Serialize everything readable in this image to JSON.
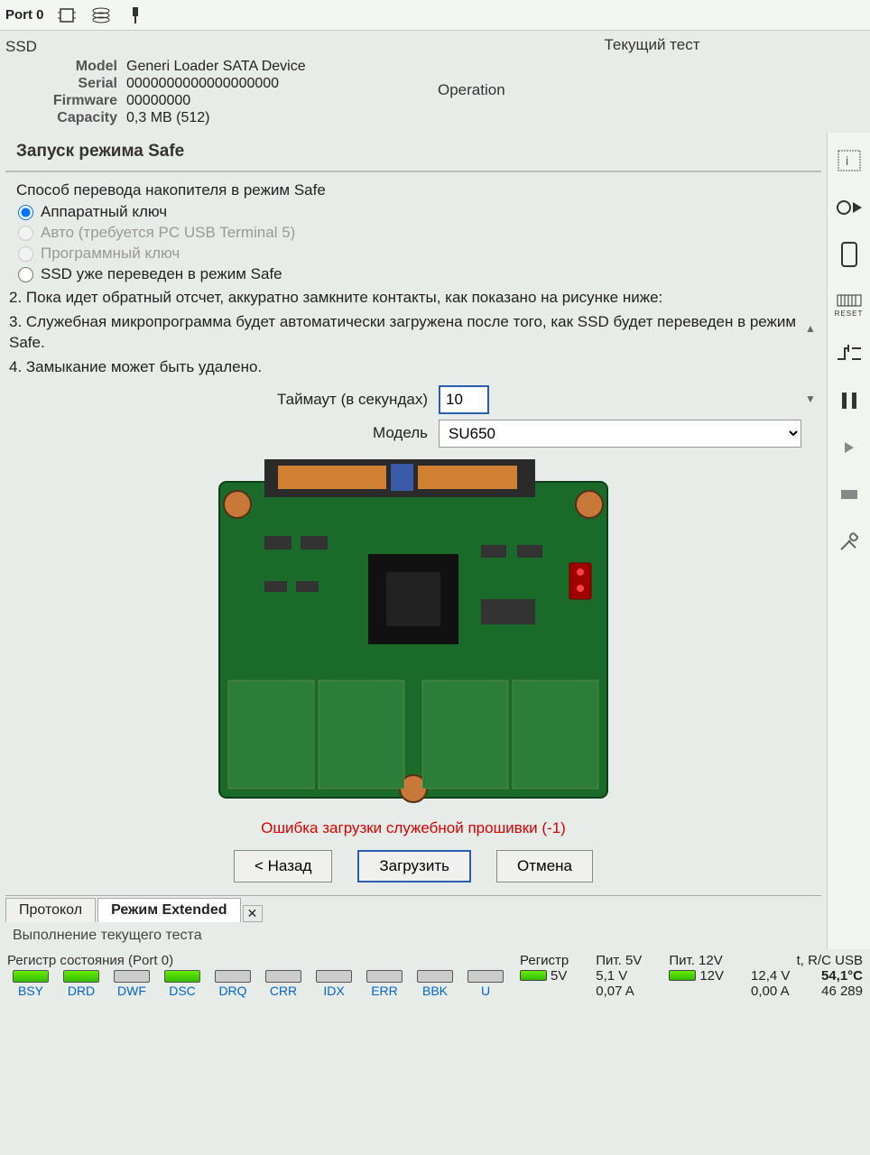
{
  "toolbar": {
    "port_label": "Port 0"
  },
  "info": {
    "ssd_tab": "SSD",
    "model_label": "Model",
    "model_value": "Generi Loader SATA Device",
    "serial_label": "Serial",
    "serial_value": "0000000000000000000",
    "firmware_label": "Firmware",
    "firmware_value": "00000000",
    "capacity_label": "Capacity",
    "capacity_value": "0,3 MB (512)"
  },
  "test": {
    "current_test_label": "Текущий тест",
    "operation_label": "Operation"
  },
  "panel": {
    "title": "Запуск режима Safe",
    "method_label": "Способ перевода накопителя в режим Safe",
    "radio": {
      "hw_key": "Аппаратный ключ",
      "auto": "Авто (требуется PC USB Terminal 5)",
      "sw_key": "Программный ключ",
      "already_safe": "SSD уже переведен в режим Safe"
    },
    "instructions": {
      "step2": "2. Пока идет обратный отсчет, аккуратно замкните контакты, как показано на рисунке ниже:",
      "step3": "3. Служебная микропрограмма будет автоматически загружена после того, как SSD будет переведен в режим Safe.",
      "step4": "4. Замыкание может быть удалено."
    },
    "timeout_label": "Таймаут (в секундах)",
    "timeout_value": "10",
    "model_label": "Модель",
    "model_selected": "SU650",
    "error_message": "Ошибка загрузки служебной прошивки (-1)",
    "buttons": {
      "back": "< Назад",
      "load": "Загрузить",
      "cancel": "Отмена"
    }
  },
  "tabs": {
    "protocol": "Протокол",
    "extended": "Режим Extended"
  },
  "status_line": "Выполнение текущего теста",
  "footer": {
    "register_title": "Регистр состояния (Port 0)",
    "flags": [
      "BSY",
      "DRD",
      "DWF",
      "DSC",
      "DRQ",
      "CRR",
      "IDX",
      "ERR",
      "BBK",
      "U"
    ],
    "flag_states": [
      "green",
      "green",
      "gray",
      "green",
      "gray",
      "gray",
      "gray",
      "gray",
      "gray",
      "gray"
    ],
    "register_label": "Регистр",
    "pwr5_label": "Пит. 5V",
    "pwr5_v": "5,1 V",
    "pwr5_a": "0,07 A",
    "pwr5_led": "5V",
    "pwr12_label": "Пит. 12V",
    "pwr12_v": "12,4 V",
    "pwr12_a": "0,00 A",
    "pwr12_led": "12V",
    "temp_label": "t, R/C USB",
    "temp_value": "54,1°C",
    "temp_count": "46 289"
  },
  "side": {
    "reset_label": "RESET"
  }
}
